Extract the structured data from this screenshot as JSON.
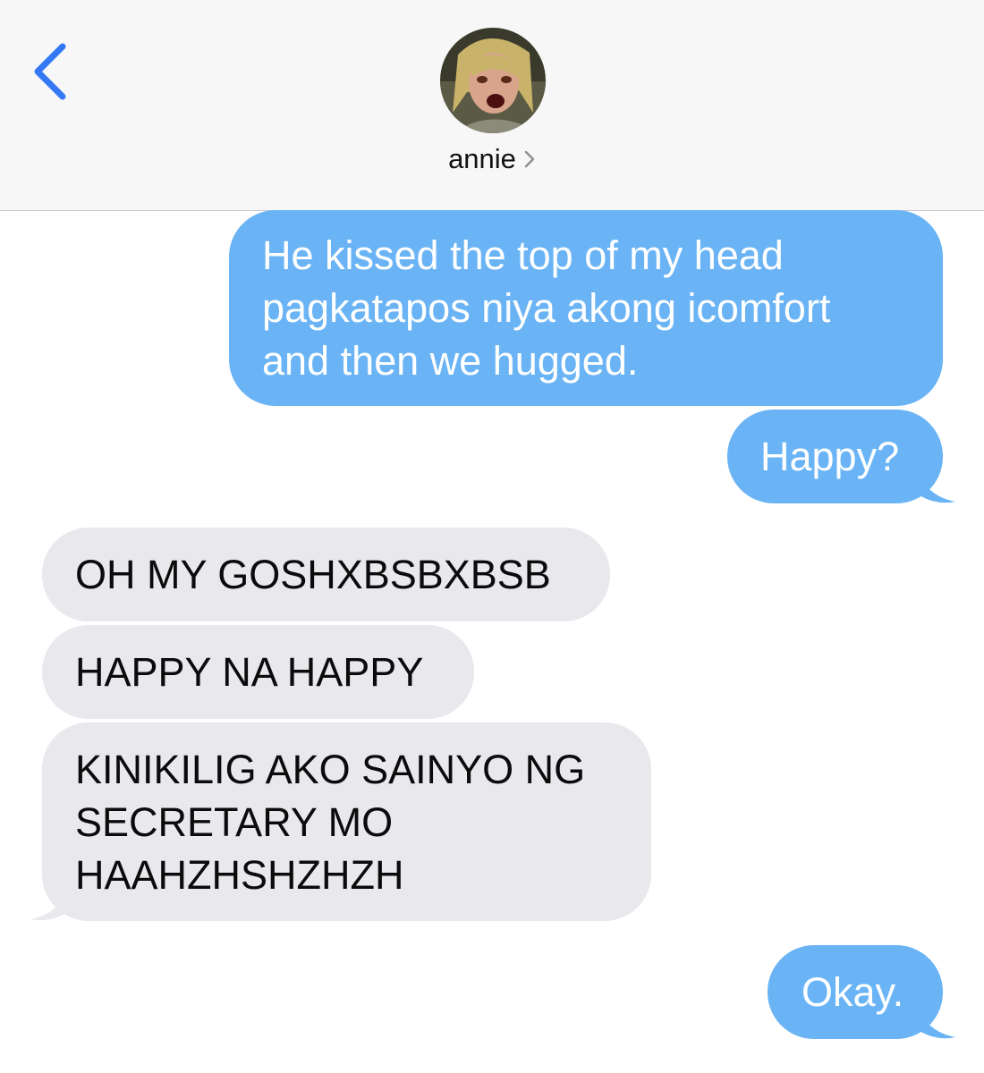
{
  "header": {
    "back_icon": "chevron-left-icon",
    "contact_name": "annie",
    "contact_chevron_icon": "chevron-right-icon",
    "avatar_icon": "contact-avatar-photo"
  },
  "messages": [
    {
      "direction": "outgoing",
      "lines": [
        "He kissed the top of my head",
        "pagkatapos niya akong icomfort",
        "and then we hugged."
      ]
    },
    {
      "direction": "outgoing",
      "lines": [
        "Happy?"
      ]
    },
    {
      "direction": "incoming",
      "lines": [
        "OH MY GOSHXBSBXBSB"
      ]
    },
    {
      "direction": "incoming",
      "lines": [
        "HAPPY NA HAPPY"
      ]
    },
    {
      "direction": "incoming",
      "lines": [
        "KINIKILIG AKO SAINYO NG",
        "SECRETARY MO",
        "HAAHZHSHZHZH"
      ]
    },
    {
      "direction": "outgoing",
      "lines": [
        "Okay."
      ]
    }
  ],
  "colors": {
    "accent": "#3478f6",
    "outgoing_bubble": "#6ab4f5",
    "incoming_bubble": "#e8e8ed",
    "header_bg": "#f7f7f7"
  }
}
